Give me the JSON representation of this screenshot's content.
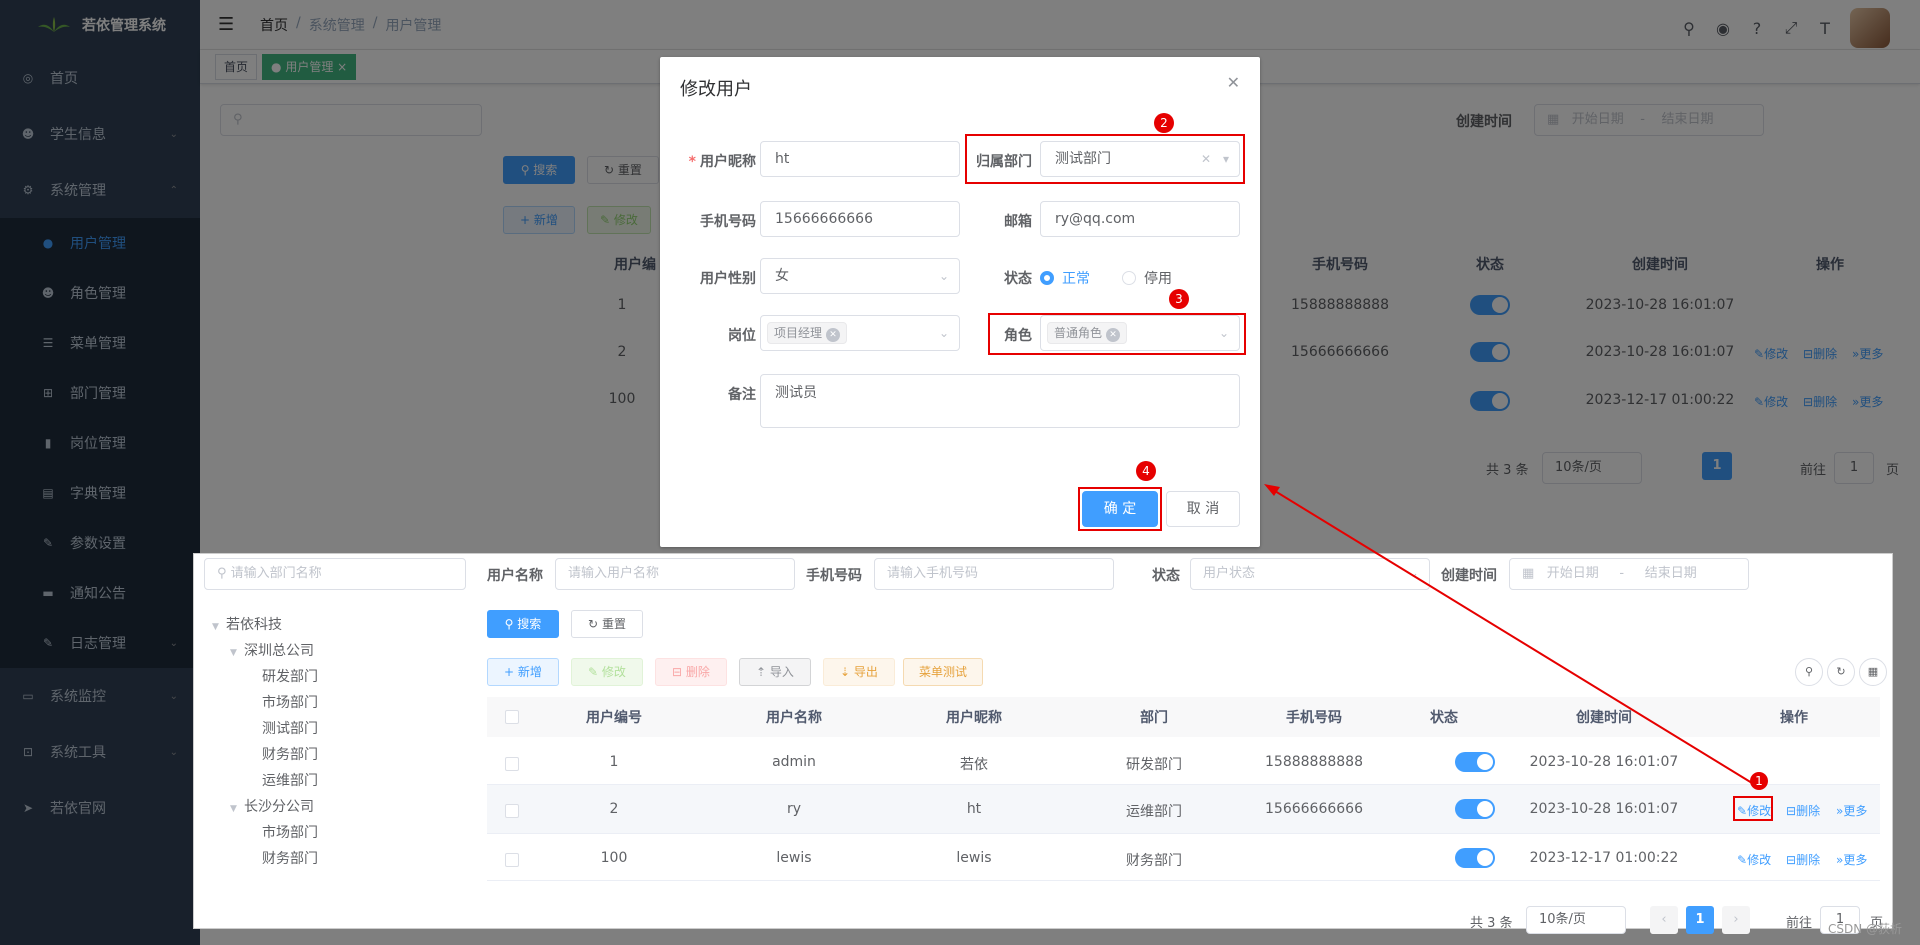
{
  "app": {
    "title": "若依管理系统"
  },
  "sidebar": {
    "items": [
      {
        "label": "首页",
        "icon": "dashboard-icon"
      },
      {
        "label": "学生信息",
        "icon": "people-icon",
        "expandable": true
      },
      {
        "label": "系统管理",
        "icon": "gear-icon",
        "expandable": true,
        "expanded": true
      }
    ],
    "sub_items": [
      {
        "label": "用户管理",
        "icon": "user-icon",
        "active": true
      },
      {
        "label": "角色管理",
        "icon": "peoples-icon"
      },
      {
        "label": "菜单管理",
        "icon": "tree-table-icon"
      },
      {
        "label": "部门管理",
        "icon": "tree-icon"
      },
      {
        "label": "岗位管理",
        "icon": "post-icon"
      },
      {
        "label": "字典管理",
        "icon": "dict-icon"
      },
      {
        "label": "参数设置",
        "icon": "edit-icon"
      },
      {
        "label": "通知公告",
        "icon": "message-icon"
      },
      {
        "label": "日志管理",
        "icon": "log-icon",
        "expandable": true
      }
    ],
    "items_after": [
      {
        "label": "系统监控",
        "icon": "monitor-icon",
        "expandable": true
      },
      {
        "label": "系统工具",
        "icon": "tool-icon",
        "expandable": true
      },
      {
        "label": "若依官网",
        "icon": "guide-icon"
      }
    ]
  },
  "navbar": {
    "breadcrumb": [
      "首页",
      "/",
      "系统管理",
      "/",
      "用户管理"
    ]
  },
  "tags": [
    {
      "label": "首页"
    },
    {
      "label": "用户管理",
      "active": true
    }
  ],
  "dialog": {
    "title": "修改用户",
    "nickname_label": "用户昵称",
    "nickname_value": "ht",
    "dept_label": "归属部门",
    "dept_value": "测试部门",
    "phone_label": "手机号码",
    "phone_value": "15666666666",
    "email_label": "邮箱",
    "email_value": "ry@qq.com",
    "sex_label": "用户性别",
    "sex_value": "女",
    "status_label": "状态",
    "status_options": [
      "正常",
      "停用"
    ],
    "status_selected": "正常",
    "post_label": "岗位",
    "post_chip": "项目经理",
    "role_label": "角色",
    "role_chip": "普通角色",
    "remark_label": "备注",
    "remark_value": "测试员",
    "confirm_label": "确 定",
    "cancel_label": "取 消",
    "badges": [
      "2",
      "3",
      "4"
    ]
  },
  "panel": {
    "dept_search_placeholder": "请输入部门名称",
    "username_label": "用户名称",
    "username_placeholder": "请输入用户名称",
    "phone_label": "手机号码",
    "phone_placeholder": "请输入手机号码",
    "status_label": "状态",
    "status_placeholder": "用户状态",
    "created_label": "创建时间",
    "date_start": "开始日期",
    "date_sep": "-",
    "date_end": "结束日期",
    "search_btn": "搜索",
    "reset_btn": "重置",
    "toolbar": [
      "新增",
      "修改",
      "删除",
      "导入",
      "导出",
      "菜单测试"
    ],
    "tree": [
      {
        "label": "若依科技",
        "level": 0,
        "caret": true
      },
      {
        "label": "深圳总公司",
        "level": 1,
        "caret": true
      },
      {
        "label": "研发部门",
        "level": 2
      },
      {
        "label": "市场部门",
        "level": 2
      },
      {
        "label": "测试部门",
        "level": 2
      },
      {
        "label": "财务部门",
        "level": 2
      },
      {
        "label": "运维部门",
        "level": 2
      },
      {
        "label": "长沙分公司",
        "level": 1,
        "caret": true
      },
      {
        "label": "市场部门",
        "level": 2
      },
      {
        "label": "财务部门",
        "level": 2
      }
    ],
    "columns": [
      "用户编号",
      "用户名称",
      "用户昵称",
      "部门",
      "手机号码",
      "状态",
      "创建时间",
      "操作"
    ],
    "rows": [
      {
        "id": "1",
        "username": "admin",
        "nickname": "若依",
        "dept": "研发部门",
        "phone": "15888888888",
        "created": "2023-10-28 16:01:07",
        "ops": []
      },
      {
        "id": "2",
        "username": "ry",
        "nickname": "ht",
        "dept": "运维部门",
        "phone": "15666666666",
        "created": "2023-10-28 16:01:07",
        "ops": [
          "修改",
          "删除",
          "更多"
        ]
      },
      {
        "id": "100",
        "username": "lewis",
        "nickname": "lewis",
        "dept": "财务部门",
        "phone": "",
        "created": "2023-12-17 01:00:22",
        "ops": [
          "修改",
          "删除",
          "更多"
        ]
      }
    ],
    "badge": "1",
    "pagination": {
      "total": "共 3 条",
      "page_size": "10条/页",
      "current": "1",
      "goto_label": "前往",
      "goto_value": "1",
      "page_unit": "页"
    }
  },
  "background": {
    "created_label": "创建时间",
    "date_start": "开始日期",
    "date_sep": "-",
    "date_end": "结束日期",
    "search_btn": "搜索",
    "reset_btn": "重置",
    "add_btn": "新增",
    "edit_btn": "修改",
    "user_id_col": "用户编",
    "phone_col": "手机号码",
    "status_col": "状态",
    "created_col": "创建时间",
    "ops_col": "操作",
    "rows": [
      {
        "id": "1",
        "phone": "15888888888",
        "created": "2023-10-28 16:01:07",
        "ops": []
      },
      {
        "id": "2",
        "phone": "15666666666",
        "created": "2023-10-28 16:01:07",
        "ops": [
          "修改",
          "删除",
          "更多"
        ]
      },
      {
        "id": "100",
        "phone": "",
        "created": "2023-12-17 01:00:22",
        "ops": [
          "修改",
          "删除",
          "更多"
        ]
      }
    ],
    "pagination": {
      "total": "共 3 条",
      "page_size": "10条/页",
      "current": "1",
      "goto_label": "前往",
      "goto_value": "1",
      "page_unit": "页"
    }
  },
  "watermark": "CSDN @荻析",
  "colors": {
    "sidebar": "#304156",
    "primary": "#409eff",
    "annotation_red": "#e60000"
  }
}
